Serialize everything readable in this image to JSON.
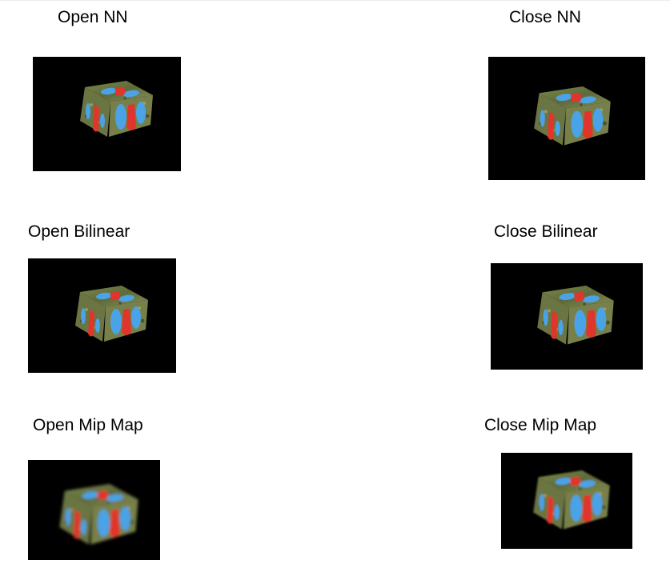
{
  "panels": {
    "open_nn": {
      "caption": "Open NN"
    },
    "close_nn": {
      "caption": "Close NN"
    },
    "open_bilinear": {
      "caption": "Open Bilinear"
    },
    "close_bilinear": {
      "caption": "Close Bilinear"
    },
    "open_mipmap": {
      "caption": "Open Mip Map"
    },
    "close_mipmap": {
      "caption": "Close Mip Map"
    }
  },
  "colors": {
    "background": "#000000",
    "cube_fur": "#6f7a45",
    "cube_fur_dark": "#3f4628",
    "cube_blue": "#4aa3e6",
    "cube_red": "#e0352b"
  }
}
